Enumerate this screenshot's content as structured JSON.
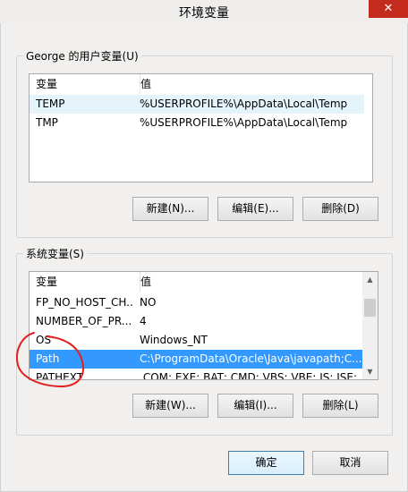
{
  "window": {
    "title": "环境变量",
    "close_glyph": "✕"
  },
  "user_vars": {
    "group_label": "George 的用户变量(U)",
    "columns": [
      "变量",
      "值"
    ],
    "rows": [
      {
        "name": "TEMP",
        "value": "%USERPROFILE%\\AppData\\Local\\Temp"
      },
      {
        "name": "TMP",
        "value": "%USERPROFILE%\\AppData\\Local\\Temp"
      }
    ],
    "buttons": {
      "new": "新建(N)...",
      "edit": "编辑(E)...",
      "delete": "删除(D)"
    }
  },
  "system_vars": {
    "group_label": "系统变量(S)",
    "columns": [
      "变量",
      "值"
    ],
    "rows": [
      {
        "name": "FP_NO_HOST_CH...",
        "value": "NO"
      },
      {
        "name": "NUMBER_OF_PR...",
        "value": "4"
      },
      {
        "name": "OS",
        "value": "Windows_NT"
      },
      {
        "name": "Path",
        "value": "C:\\ProgramData\\Oracle\\Java\\javapath;C..."
      },
      {
        "name": "PATHEXT",
        "value": ".COM;.EXE;.BAT;.CMD;.VBS;.VBE;.JS;.JSE;..."
      }
    ],
    "selected_index": 3,
    "buttons": {
      "new": "新建(W)...",
      "edit": "编辑(I)...",
      "delete": "删除(L)"
    }
  },
  "footer": {
    "ok": "确定",
    "cancel": "取消"
  },
  "colors": {
    "selection": "#3399ff",
    "annotation": "#e02020",
    "close": "#c42b1c"
  },
  "icons": {
    "close": "close-icon",
    "scroll_up": "scroll-up-arrow-icon",
    "scroll_down": "scroll-down-arrow-icon"
  }
}
